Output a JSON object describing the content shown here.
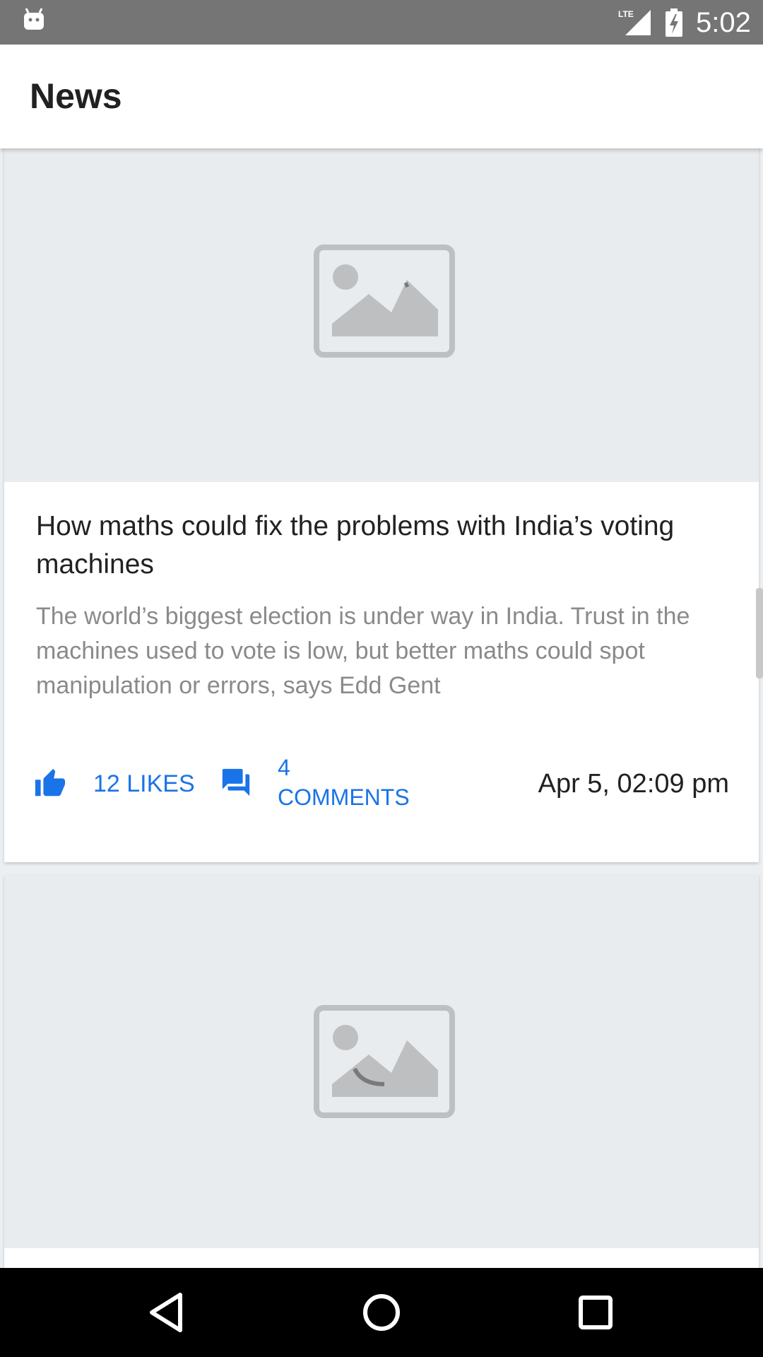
{
  "status_bar": {
    "time": "5:02",
    "network": "LTE",
    "icons": [
      "android-icon",
      "lte-signal-icon",
      "battery-charging-icon"
    ]
  },
  "app_bar": {
    "title": "News"
  },
  "articles": [
    {
      "image_icon": "image-placeholder-icon",
      "title": "How maths could fix the problems with India’s voting machines",
      "summary": "The world’s biggest election is under way in India. Trust in the machines used to vote is low, but better maths could spot manipulation or errors, says Edd Gent",
      "likes_label": "12 LIKES",
      "comments_count": "4",
      "comments_label": "COMMENTS",
      "timestamp": "Apr 5, 02:09 pm"
    },
    {
      "image_icon": "image-placeholder-icon"
    }
  ],
  "colors": {
    "accent": "#1a73e8",
    "status_bar": "#757575",
    "image_bg": "#e8ecee",
    "feed_bg": "#eceff1"
  },
  "nav_bar": {
    "icons": [
      "back-icon",
      "home-icon",
      "recents-icon"
    ]
  }
}
